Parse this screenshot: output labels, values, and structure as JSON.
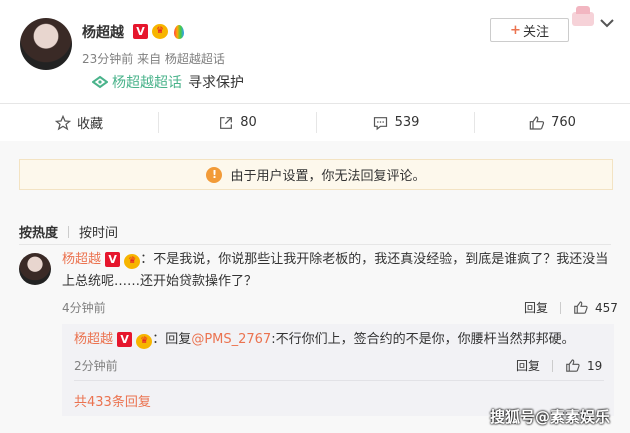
{
  "post": {
    "author": "杨超越",
    "time": "23分钟前",
    "source": "来自 杨超越超话",
    "supertopic": "杨超越超话",
    "text": "寻求保护",
    "follow_label": "关注",
    "follow_plus": "+"
  },
  "toolbar": {
    "favorite": "收藏",
    "repost_count": "80",
    "comment_count": "539",
    "like_count": "760"
  },
  "notice": "由于用户设置，你无法回复评论。",
  "tabs": {
    "hot": "按热度",
    "time": "按时间"
  },
  "comment": {
    "author": "杨超越",
    "text": "：不是我说，你说那些让我开除老板的，我还真没经验，到底是谁疯了？我还没当上总统呢……还开始贷款操作了？",
    "time": "4分钟前",
    "reply_label": "回复",
    "likes": "457"
  },
  "reply": {
    "author": "杨超越",
    "prefix": "：回复",
    "mention": "@PMS_2767",
    "text": ":不行你们上，签合约的不是你，你腰杆当然邦邦硬。",
    "time": "2分钟前",
    "reply_label": "回复",
    "likes": "19"
  },
  "more_replies": "共433条回复",
  "watermark": "搜狐号@素素娱乐",
  "badges": {
    "v": "V",
    "crown": "♛"
  },
  "colors": {
    "accent": "#eb7350",
    "link_green": "#4ab38b",
    "verified_red": "#e6162d"
  },
  "icons": [
    "star-icon",
    "repost-icon",
    "comment-icon",
    "like-icon",
    "chevron-down-icon",
    "warning-icon",
    "supertopic-icon"
  ]
}
